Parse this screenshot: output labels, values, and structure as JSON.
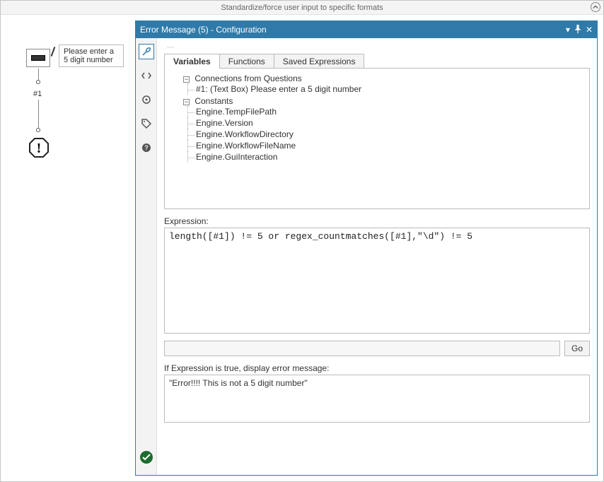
{
  "app_header": {
    "title": "Standardize/force user input to specific formats"
  },
  "canvas": {
    "tooltip": "Please enter a 5 digit number",
    "node_label": "#1"
  },
  "panel": {
    "title": "Error Message (5) - Configuration",
    "tabs": {
      "variables": "Variables",
      "functions": "Functions",
      "saved": "Saved Expressions"
    },
    "tree": {
      "connections_label": "Connections from Questions",
      "connection_item": "#1: (Text Box) Please enter a 5 digit number",
      "constants_label": "Constants",
      "constants": [
        "Engine.TempFilePath",
        "Engine.Version",
        "Engine.WorkflowDirectory",
        "Engine.WorkflowFileName",
        "Engine.GuiInteraction"
      ]
    },
    "expression_label": "Expression:",
    "expression_value": "length([#1]) != 5 or regex_countmatches([#1],\"\\d\") != 5",
    "go_label": "Go",
    "error_label": "If Expression is true, display error message:",
    "error_value": "\"Error!!!! This is not a 5 digit number\""
  },
  "sidebar_icons": {
    "wrench": "wrench-icon",
    "code": "code-icon",
    "target": "target-icon",
    "tag": "tag-icon",
    "help": "help-icon",
    "check": "validate-icon"
  }
}
